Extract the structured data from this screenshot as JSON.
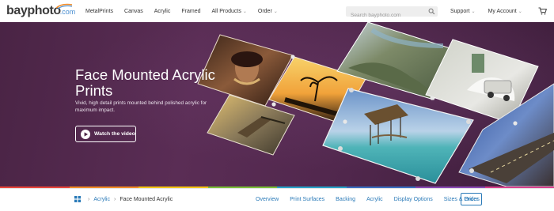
{
  "header": {
    "logo_text": "bayphoto",
    "logo_suffix": ".com",
    "nav": [
      {
        "label": "MetalPrints",
        "dropdown": false
      },
      {
        "label": "Canvas",
        "dropdown": false
      },
      {
        "label": "Acrylic",
        "dropdown": false
      },
      {
        "label": "Framed",
        "dropdown": false
      },
      {
        "label": "All Products",
        "dropdown": true
      },
      {
        "label": "Order",
        "dropdown": true
      }
    ],
    "search_placeholder": "Search bayphoto.com",
    "support_label": "Support",
    "account_label": "My Account"
  },
  "hero": {
    "title": "Face Mounted Acrylic Prints",
    "subtitle": "Vivid, high detail prints mounted behind polished acrylic for maximum impact.",
    "button_label": "Watch the video"
  },
  "color_strip": [
    "#e8463c",
    "#f28c28",
    "#f5c518",
    "#7cbf3a",
    "#2aa3c9",
    "#3b6fc1",
    "#8a4ab3",
    "#d9418e"
  ],
  "subnav": {
    "breadcrumb": {
      "parent": "Acrylic",
      "current": "Face Mounted Acrylic"
    },
    "links": [
      "Overview",
      "Print Surfaces",
      "Backing",
      "Acrylic",
      "Display Options",
      "Sizes & Prices"
    ],
    "order_label": "Order"
  },
  "colors": {
    "hero_bg": "#4a2445",
    "link_blue": "#2a7ab8"
  }
}
